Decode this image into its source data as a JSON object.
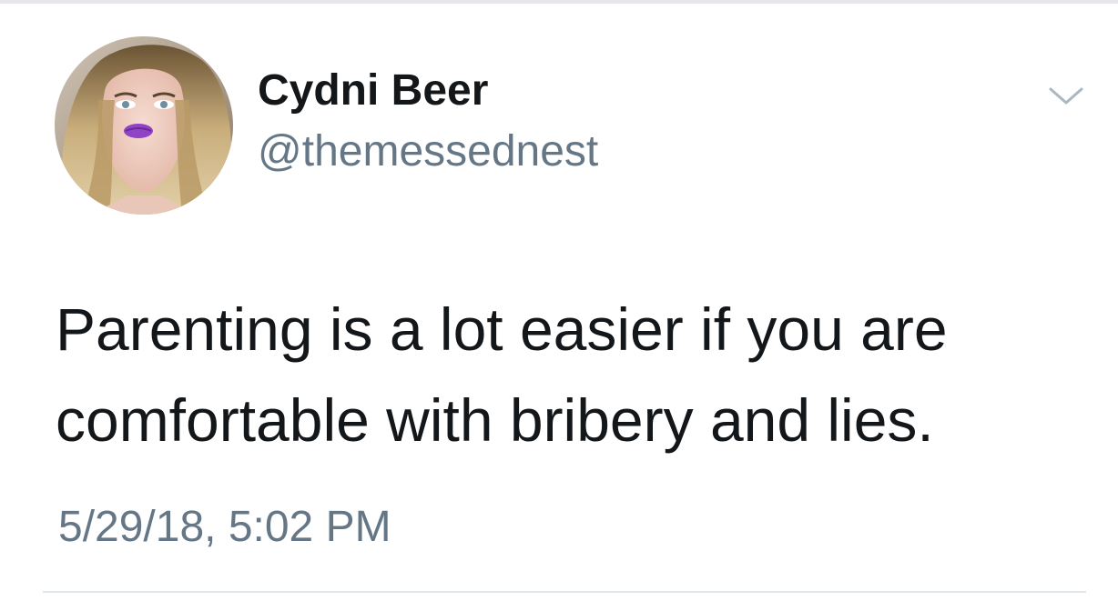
{
  "tweet": {
    "author": {
      "display_name": "Cydni Beer",
      "handle": "@themessednest",
      "avatar": "profile-photo"
    },
    "text_lines": [
      "Parenting is a lot easier if you are",
      "comfortable with bribery and lies."
    ],
    "timestamp": "5/29/18, 5:02 PM",
    "menu_icon": "chevron-down-icon"
  },
  "colors": {
    "text_primary": "#14171a",
    "text_secondary": "#657786",
    "divider": "#e1e8ed",
    "background": "#ffffff"
  }
}
